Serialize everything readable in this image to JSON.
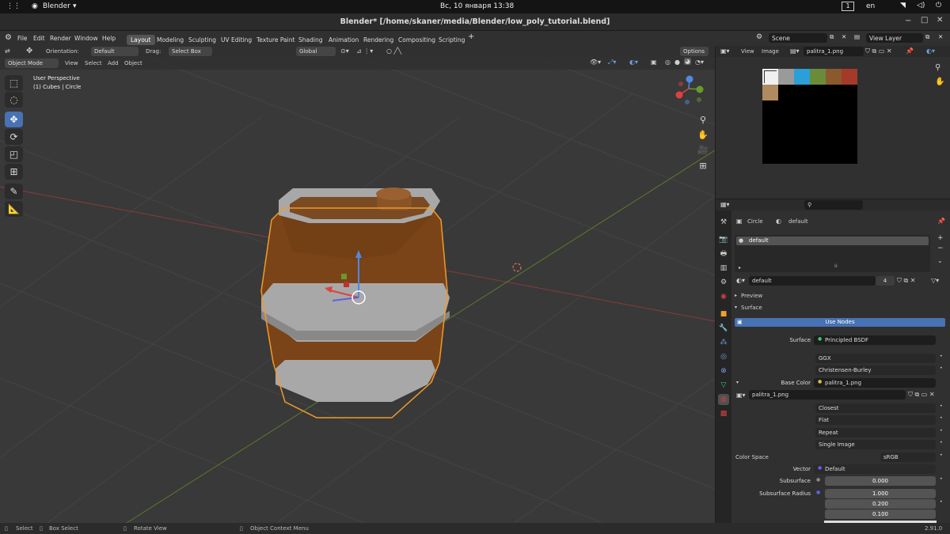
{
  "os": {
    "app_name": "Blender",
    "clock": "Вс, 10 января 13:38",
    "workspace_num": "1",
    "lang": "en"
  },
  "window_title": "Blender* [/home/skaner/media/Blender/low_poly_tutorial.blend]",
  "menu": [
    "File",
    "Edit",
    "Render",
    "Window",
    "Help"
  ],
  "workspaces": [
    "Layout",
    "Modeling",
    "Sculpting",
    "UV Editing",
    "Texture Paint",
    "Shading",
    "Animation",
    "Rendering",
    "Compositing",
    "Scripting"
  ],
  "scene": {
    "name": "Scene",
    "view_layer": "View Layer"
  },
  "tool_header": {
    "orientation_label": "Orientation:",
    "orientation_value": "Default",
    "drag_label": "Drag:",
    "drag_value": "Select Box",
    "transform_space": "Global",
    "options": "Options"
  },
  "viewport_header": {
    "mode": "Object Mode",
    "items": [
      "View",
      "Select",
      "Add",
      "Object"
    ]
  },
  "viewport": {
    "perspective": "User Perspective",
    "object_info": "(1) Cubes | Circle"
  },
  "image_editor": {
    "menu": [
      "View",
      "Image"
    ],
    "image_name": "palitra_1.png"
  },
  "properties": {
    "breadcrumb_object": "Circle",
    "breadcrumb_material": "default",
    "slot_name": "default",
    "material_name": "default",
    "users": "4",
    "panel_preview": "Preview",
    "panel_surface": "Surface",
    "use_nodes": "Use Nodes",
    "surface_label": "Surface",
    "surface_value": "Principled BSDF",
    "distribution": "GGX",
    "subsurface_method": "Christensen-Burley",
    "base_color_label": "Base Color",
    "base_color_value": "palitra_1.png",
    "image_name": "palitra_1.png",
    "interpolation": "Closest",
    "projection": "Flat",
    "extension": "Repeat",
    "source": "Single Image",
    "color_space_label": "Color Space",
    "color_space_value": "sRGB",
    "vector_label": "Vector",
    "vector_value": "Default",
    "subsurface_label": "Subsurface",
    "subsurface_value": "0.000",
    "subsurface_radius_label": "Subsurface Radius",
    "radius_values": [
      "1.000",
      "0.200",
      "0.100"
    ]
  },
  "status": {
    "select": "Select",
    "box_select": "Box Select",
    "rotate_view": "Rotate View",
    "context_menu": "Object Context Menu",
    "version": "2.91.0"
  },
  "palette_colors": [
    "#f0f0f0",
    "#9a9a9a",
    "#2b9fd6",
    "#6a8c3a",
    "#8a5a2e",
    "#a33a2a",
    "#b08a60"
  ]
}
